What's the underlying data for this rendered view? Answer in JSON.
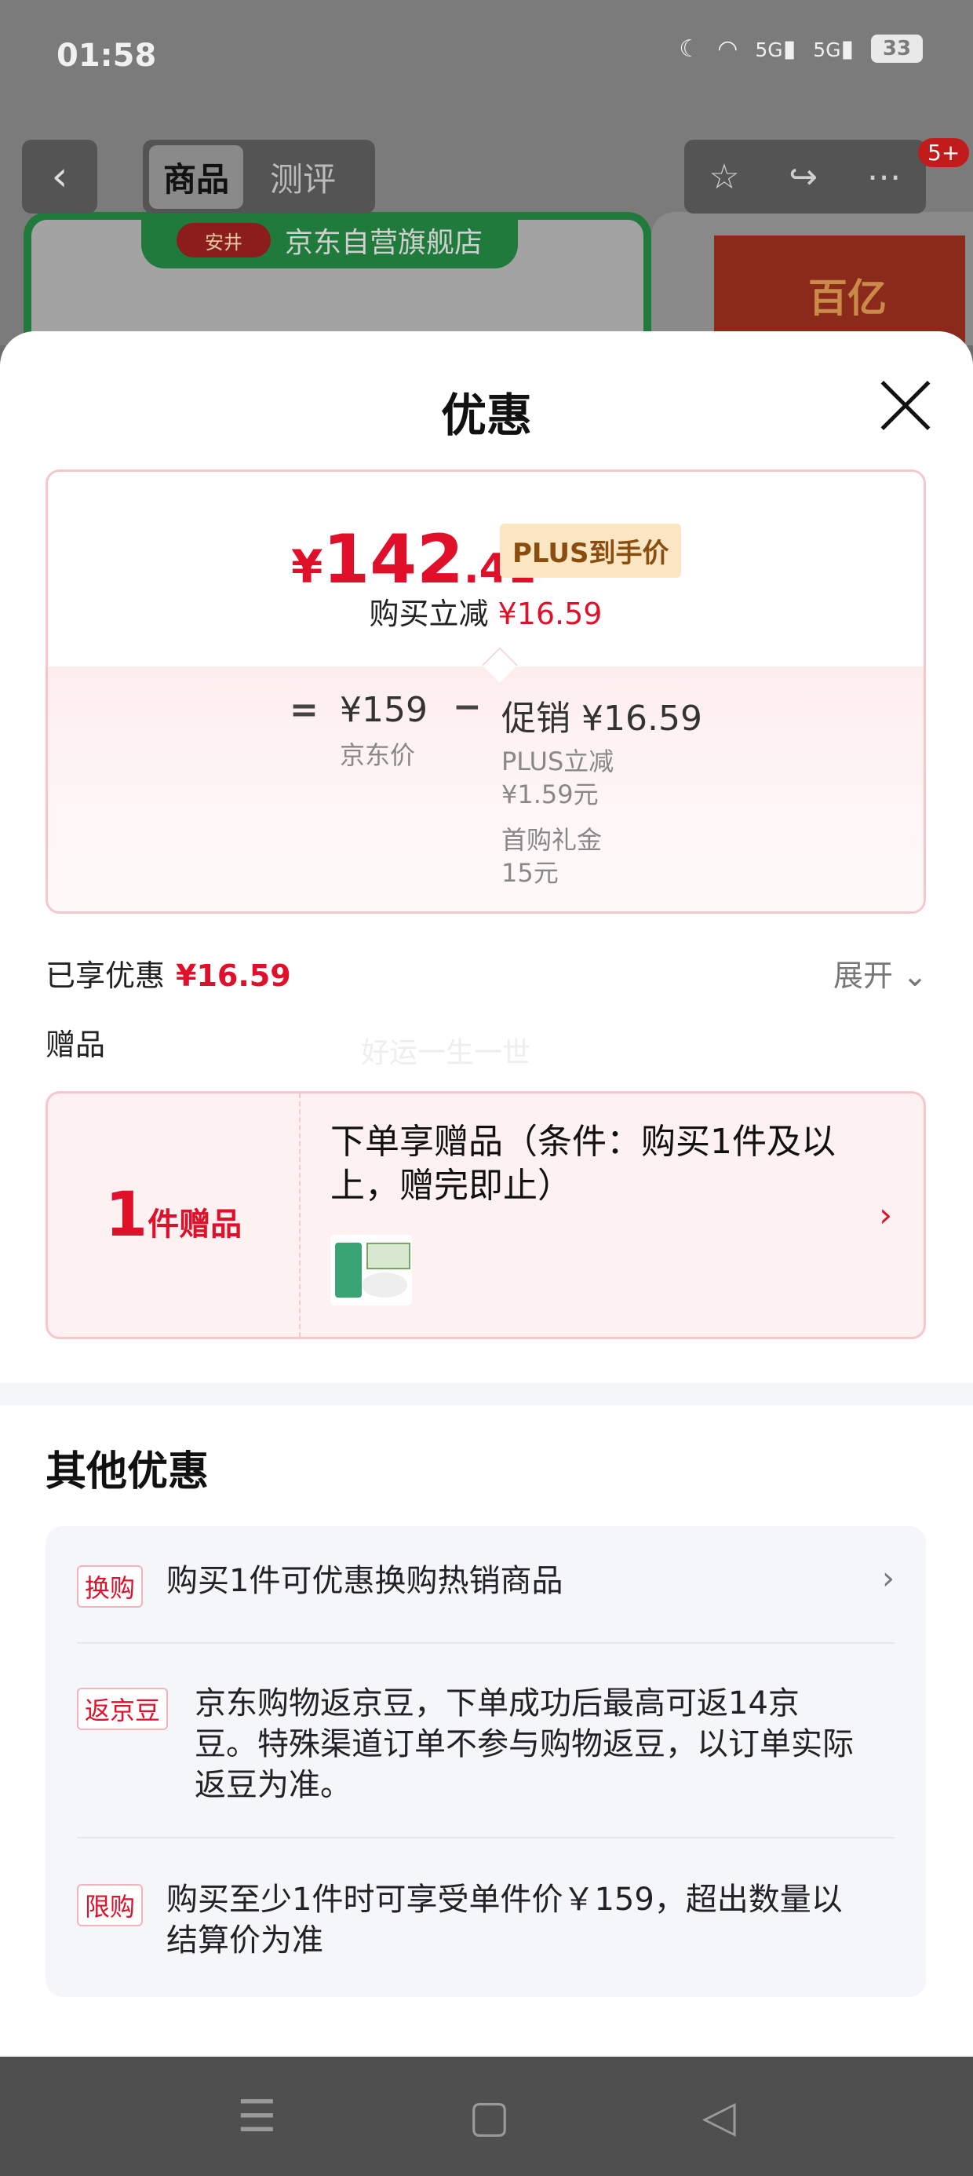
{
  "status_bar": {
    "time": "01:58",
    "battery": "33",
    "network_1": "5G",
    "network_2": "5G"
  },
  "background_page": {
    "tabs": [
      "商品",
      "测评"
    ],
    "store_name": "京东自营旗舰店",
    "store_logo_text": "安井",
    "cart_badge": "5+",
    "side_card_text": "百亿"
  },
  "sheet": {
    "title": "优惠",
    "price_card": {
      "final_symbol": "¥",
      "final_int": "142",
      "final_dec": ".41",
      "plus_tag": "PLUS到手价",
      "instant_label": "购买立减",
      "instant_value": "¥16.59",
      "eq": "=",
      "jd_price": "¥159",
      "jd_label": "京东价",
      "minus": "−",
      "promo_label": "促销 ¥16.59",
      "details": [
        "PLUS立减",
        "¥1.59元",
        "首购礼金",
        "15元"
      ]
    },
    "enjoyed_label": "已享优惠",
    "enjoyed_value": "¥16.59",
    "expand_label": "展开",
    "gift_section_title": "赠品",
    "watermark": "好运一生一世",
    "gift_card": {
      "count": "1",
      "unit": "件赠品",
      "text": "下单享赠品（条件：购买1件及以上，赠完即止）"
    },
    "other_title": "其他优惠",
    "other_items": [
      {
        "tag": "换购",
        "text": "购买1件可优惠换购热销商品"
      },
      {
        "tag": "返京豆",
        "text": "京东购物返京豆，下单成功后最高可返14京豆。特殊渠道订单不参与购物返豆，以订单实际返豆为准。"
      },
      {
        "tag": "限购",
        "text": "购买至少1件时可享受单件价￥159，超出数量以结算价为准"
      }
    ]
  },
  "colors": {
    "accent_red": "#e0102b",
    "plus_gold": "#8a4d0f",
    "store_green": "#1f7a3b"
  }
}
